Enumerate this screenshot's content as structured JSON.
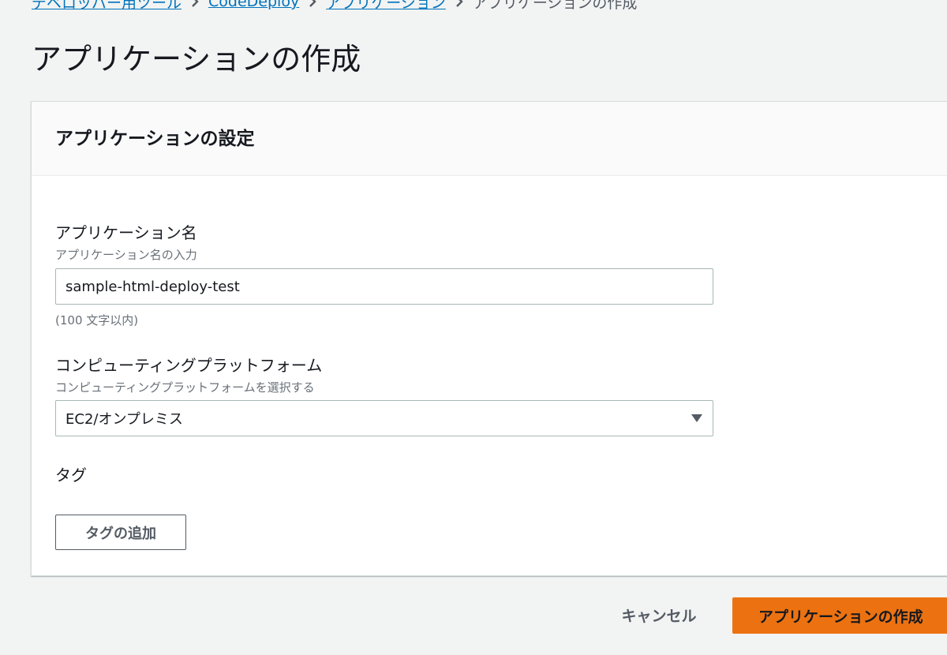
{
  "breadcrumb": {
    "items": [
      {
        "label": "デベロッパー用ツール"
      },
      {
        "label": "CodeDeploy"
      },
      {
        "label": "アプリケーション"
      },
      {
        "label": "アプリケーションの作成"
      }
    ]
  },
  "page": {
    "title": "アプリケーションの作成"
  },
  "card": {
    "title": "アプリケーションの設定",
    "app_name": {
      "label": "アプリケーション名",
      "description": "アプリケーション名の入力",
      "value": "sample-html-deploy-test",
      "constraint": "(100 文字以内)"
    },
    "platform": {
      "label": "コンピューティングプラットフォーム",
      "description": "コンピューティングプラットフォームを選択する",
      "value": "EC2/オンプレミス"
    },
    "tags": {
      "label": "タグ",
      "add_button": "タグの追加"
    }
  },
  "footer": {
    "cancel_label": "キャンセル",
    "create_label": "アプリケーションの作成"
  },
  "colors": {
    "link": "#0073bb",
    "primary": "#ec7211",
    "background": "#f2f3f3"
  },
  "icons": {
    "separator": "chevron-right-icon",
    "dropdown": "caret-down-icon"
  }
}
